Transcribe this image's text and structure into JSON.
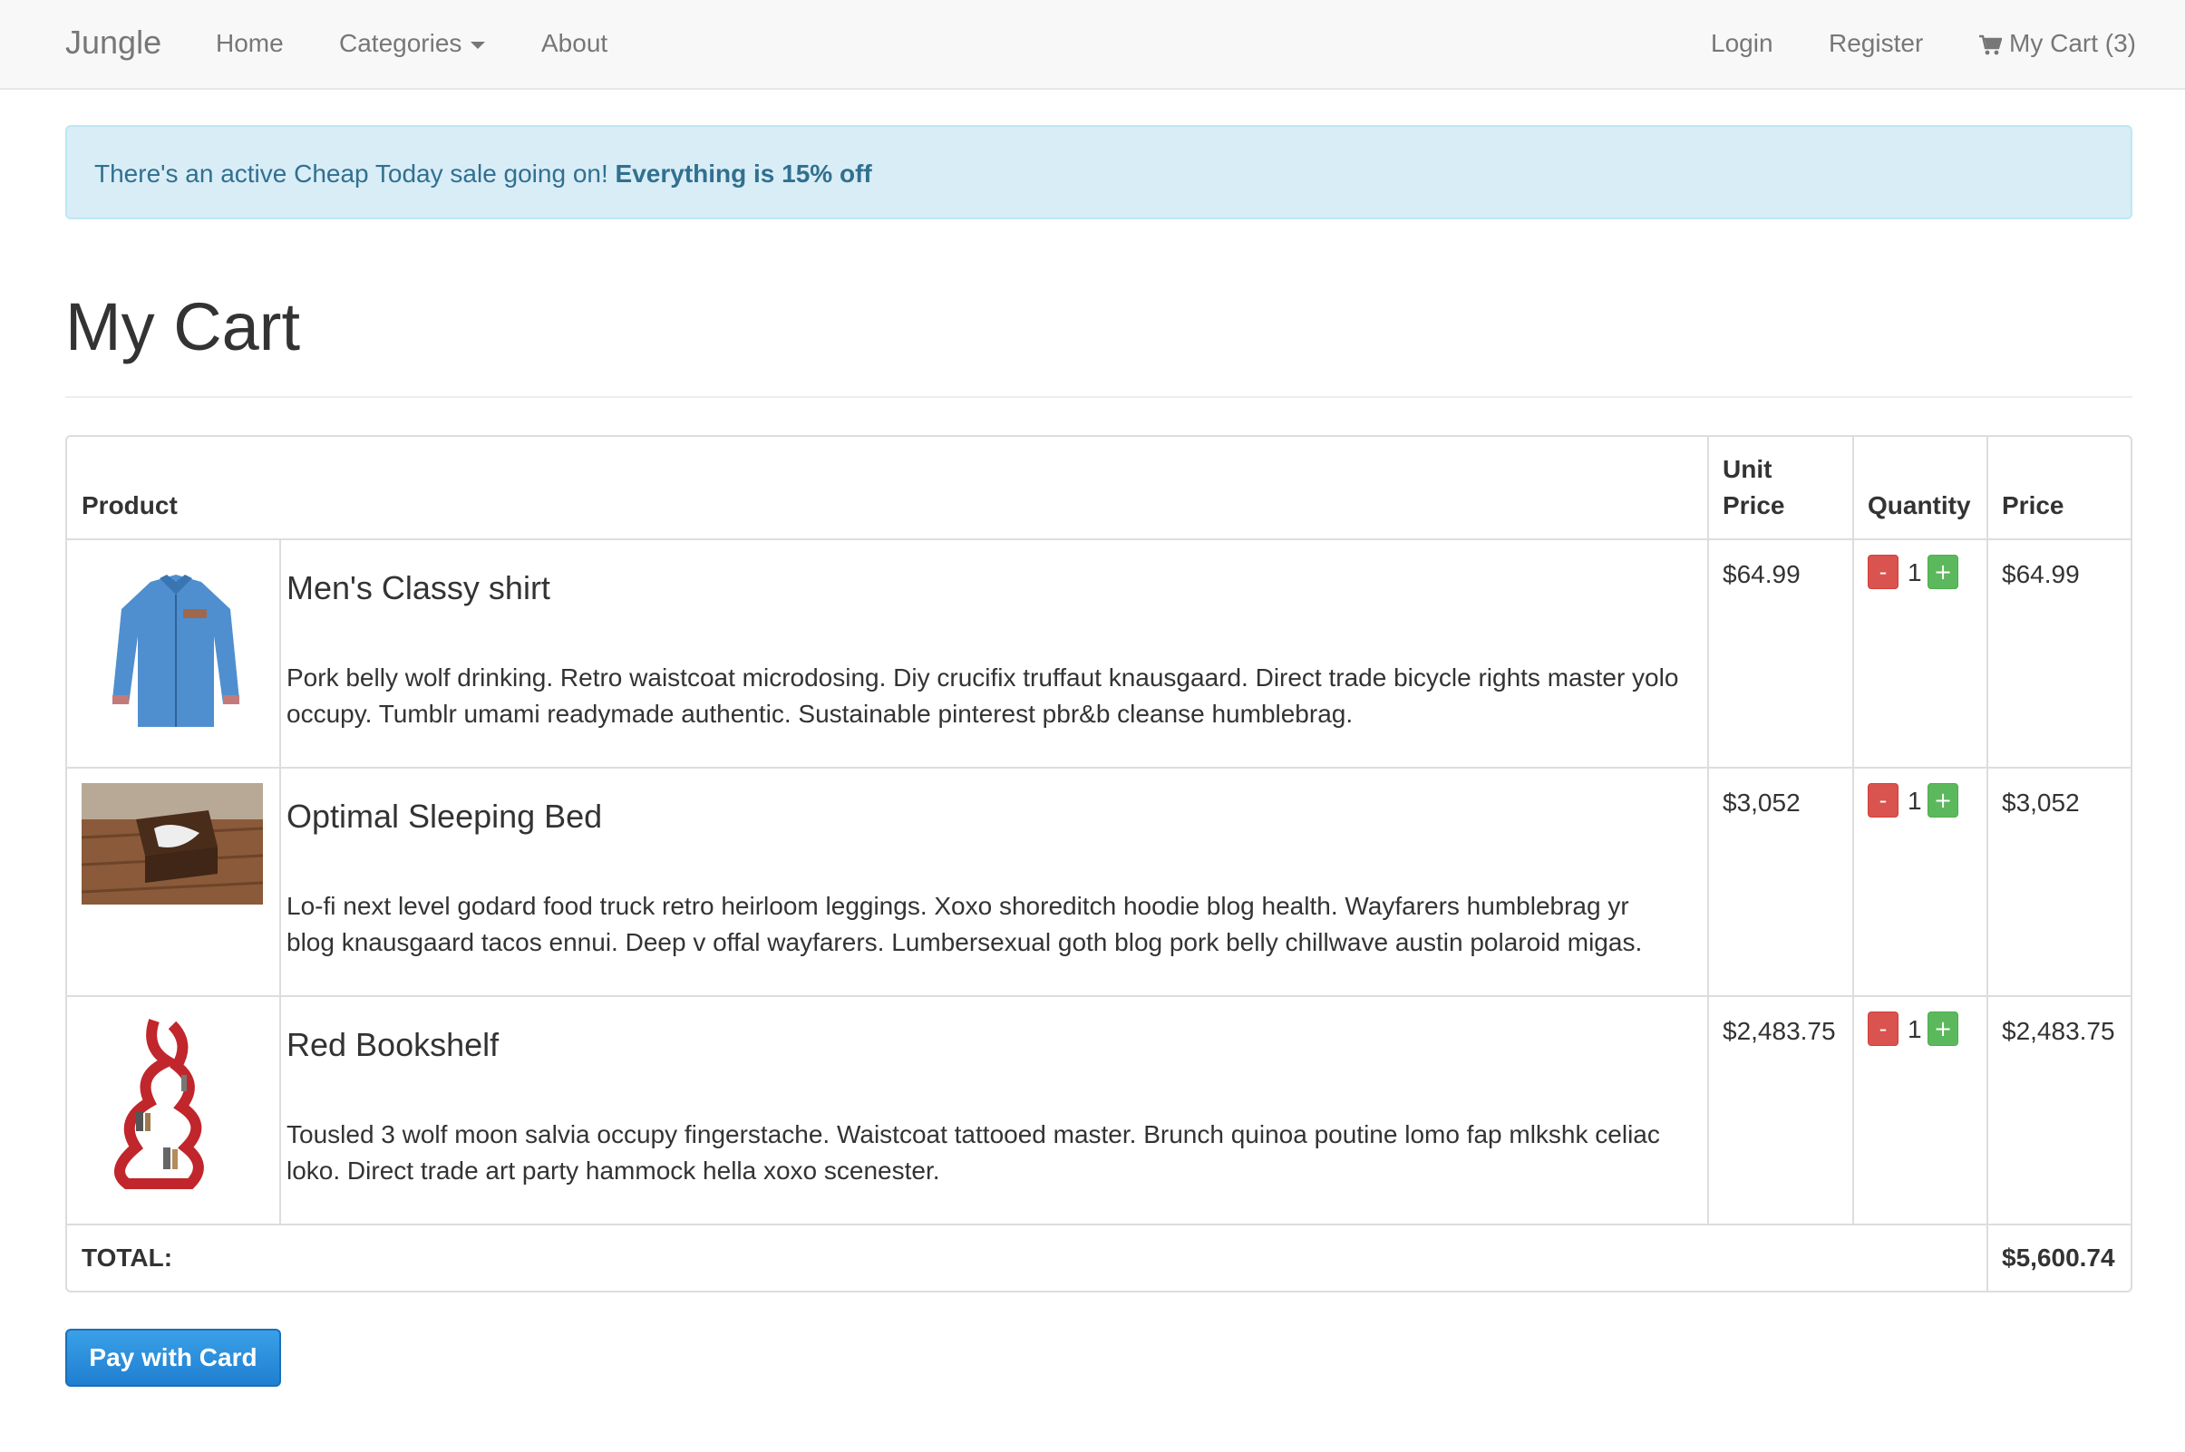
{
  "navbar": {
    "brand": "Jungle",
    "links": {
      "home": "Home",
      "categories": "Categories",
      "about": "About",
      "login": "Login",
      "register": "Register",
      "cart": "My Cart (3)"
    }
  },
  "alert": {
    "text": "There's an active Cheap Today sale going on!",
    "emphasis": "Everything is 15% off"
  },
  "page": {
    "title": "My Cart"
  },
  "table": {
    "headers": {
      "product": "Product",
      "unit_price_line1": "Unit",
      "unit_price_line2": "Price",
      "quantity": "Quantity",
      "price": "Price"
    },
    "rows": [
      {
        "name": "Men's Classy shirt",
        "description": "Pork belly wolf drinking. Retro waistcoat microdosing. Diy crucifix truffaut knausgaard. Direct trade bicycle rights master yolo occupy. Tumblr umami readymade authentic. Sustainable pinterest pbr&b cleanse humblebrag.",
        "unit_price": "$64.99",
        "quantity": "1",
        "price": "$64.99"
      },
      {
        "name": "Optimal Sleeping Bed",
        "description": "Lo-fi next level godard food truck retro heirloom leggings. Xoxo shoreditch hoodie blog health. Wayfarers humblebrag yr blog knausgaard tacos ennui. Deep v offal wayfarers. Lumbersexual goth blog pork belly chillwave austin polaroid migas.",
        "unit_price": "$3,052",
        "quantity": "1",
        "price": "$3,052"
      },
      {
        "name": "Red Bookshelf",
        "description": "Tousled 3 wolf moon salvia occupy fingerstache. Waistcoat tattooed master. Brunch quinoa poutine lomo fap mlkshk celiac loko. Direct trade art party hammock hella xoxo scenester.",
        "unit_price": "$2,483.75",
        "quantity": "1",
        "price": "$2,483.75"
      }
    ],
    "qty_minus": "-",
    "qty_plus": "+",
    "total_label": "TOTAL:",
    "total_value": "$5,600.74"
  },
  "pay_button": "Pay with Card",
  "icons": {
    "cart": "shopping-cart-icon",
    "dropdown": "caret-down-icon"
  },
  "colors": {
    "alert_bg": "#d9edf7",
    "alert_text": "#31708f",
    "minus_btn": "#d9534f",
    "plus_btn": "#5cb85c",
    "pay_btn": "#2a8fdd"
  }
}
